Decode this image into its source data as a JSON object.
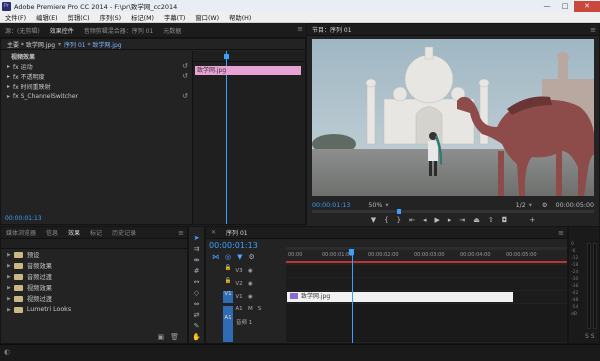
{
  "window": {
    "title": "Adobe Premiere Pro CC 2014 - F:\\pr\\致学网_cc2014",
    "min": "—",
    "max": "□",
    "close": "✕"
  },
  "menu": [
    "文件(F)",
    "编辑(E)",
    "剪辑(C)",
    "序列(S)",
    "标记(M)",
    "字幕(T)",
    "窗口(W)",
    "帮助(H)"
  ],
  "source_tabs": [
    "源：(无剪辑)",
    "效果控件",
    "音频剪辑混合器：序列 01",
    "元数据"
  ],
  "effect_controls": {
    "master": "主要 * 致学网.jpg",
    "sequence": "序列 01 * 致学网.jpg",
    "clip_label": "致学网.jpg",
    "section": "视频效果",
    "items": [
      "fx 运动",
      "fx 不透明度",
      "fx 时间重映射",
      "fx S_ChannelSwitcher"
    ],
    "timecode": "00:00:01:13"
  },
  "program": {
    "tab": "节目：序列 01",
    "timecode": "00:00:01:13",
    "zoom": "50%",
    "quality": "1/2",
    "duration": "00:00:05:00"
  },
  "project_tabs": [
    "媒体浏览器",
    "信息",
    "效果",
    "标记",
    "历史记录"
  ],
  "project_bins": [
    "预设",
    "音频效果",
    "音频过渡",
    "视频效果",
    "视频过渡",
    "Lumetri Looks"
  ],
  "timeline": {
    "tab": "序列 01",
    "timecode": "00:00:01:13",
    "ruler": [
      "00:00",
      "00:00:01:00",
      "00:00:02:00",
      "00:00:03:00",
      "00:00:04:00",
      "00:00:05:00"
    ],
    "tracks": {
      "v3": "V3",
      "v2": "V2",
      "v1": "V1",
      "a1": "A1"
    },
    "audio_track_name": "音频 1",
    "clip": "致学网.jpg",
    "m": "M",
    "s": "S"
  },
  "meter_scale": [
    "0",
    "-6",
    "-12",
    "-18",
    "-24",
    "-30",
    "-36",
    "-42",
    "-48",
    "-54",
    "dB"
  ]
}
